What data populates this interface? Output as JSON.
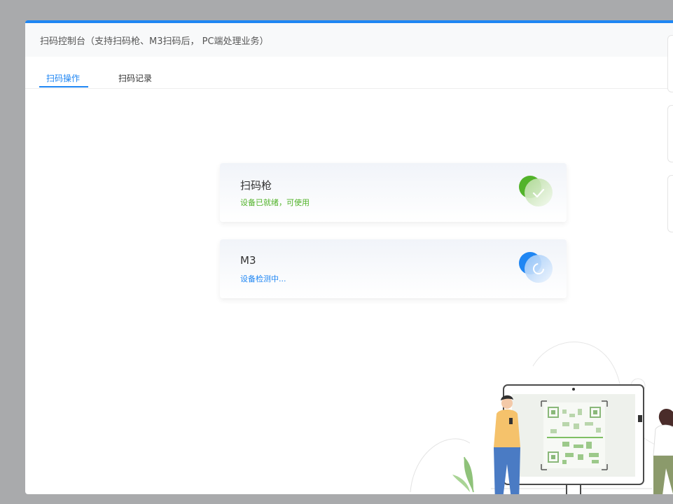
{
  "window": {
    "title": "扫码控制台（支持扫码枪、M3扫码后， PC端处理业务）"
  },
  "tabs": [
    {
      "label": "扫码操作",
      "active": true
    },
    {
      "label": "扫码记录",
      "active": false
    }
  ],
  "devices": [
    {
      "name": "扫码枪",
      "status": "设备已就绪，可使用",
      "status_color": "#52b32a",
      "icon": "check-circle-icon"
    },
    {
      "name": "M3",
      "status": "设备检测中...",
      "status_color": "#1f86f3",
      "icon": "loading-circle-icon"
    }
  ],
  "colors": {
    "accent": "#1f86f3",
    "success": "#52b32a"
  },
  "illustration": {
    "icon": "qr-scan-illustration"
  }
}
